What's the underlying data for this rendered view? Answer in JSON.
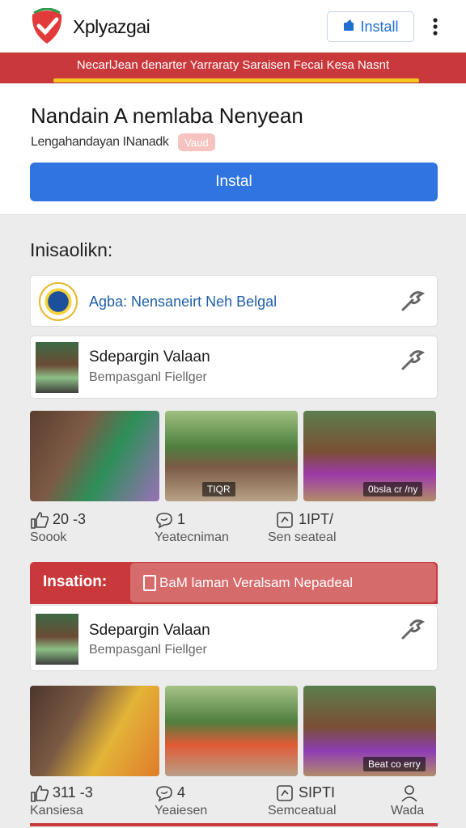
{
  "header": {
    "brand": "Xplyazgai",
    "install_label": "Install",
    "logo_icon": "check-shield-icon",
    "more_icon": "kebab-menu-icon"
  },
  "banner": {
    "text": "NecarlJean denarter Yarraraty Saraisen Fecai Kesa Nasnt"
  },
  "app": {
    "title": "Nandain A nemlaba Nenyean",
    "subtitle": "Lengahandayan INanadk",
    "badge": "Vaud",
    "install_label": "Instal"
  },
  "section": {
    "title": "Inisaolikn:"
  },
  "rows": [
    {
      "label": "Agba: Nensaneirt Neh Belgal",
      "icon": "seal-icon",
      "action_icon": "tool-icon"
    },
    {
      "name": "Sdepargin Valaan",
      "meta": "Bempasganl Fiellger",
      "icon": "avatar",
      "action_icon": "tool-icon"
    }
  ],
  "photos_1": [
    {
      "caption": ""
    },
    {
      "caption": "TIQR"
    },
    {
      "caption": "0bsla cr /ny"
    }
  ],
  "stats_1": [
    {
      "value": "20 -3",
      "label": "Soook",
      "icon": "thumbs-up-icon"
    },
    {
      "value": "1",
      "label": "Yeatecniman",
      "icon": "chat-icon"
    },
    {
      "value": "1IPT/",
      "label": "Sen seateal",
      "icon": "share-icon"
    }
  ],
  "panel": {
    "label": "Insation:",
    "pill_text": "BaM laman Veralsam Nepadeal",
    "pill_icon": "document-icon",
    "row": {
      "name": "Sdepargin Valaan",
      "meta": "Bempasganl Fiellger",
      "action_icon": "tool-icon"
    }
  },
  "photos_2": [
    {
      "caption": ""
    },
    {
      "caption": ""
    },
    {
      "caption": "Beat co erry"
    }
  ],
  "stats_2": [
    {
      "value": "311 -3",
      "label": "Kansiesa",
      "icon": "thumbs-up-icon"
    },
    {
      "value": "4",
      "label": "Yeaiesen",
      "icon": "chat-icon"
    },
    {
      "value": "SIPTI",
      "label": "Semceatual",
      "icon": "share-icon"
    },
    {
      "value": "",
      "label": "Wada",
      "icon": "person-icon"
    }
  ],
  "colors": {
    "accent": "#2f74e0",
    "banner": "#c9383b",
    "highlight": "#f2c61f"
  }
}
